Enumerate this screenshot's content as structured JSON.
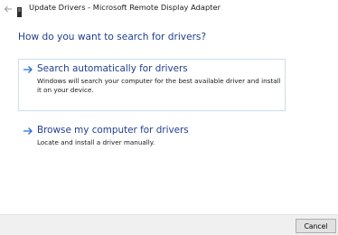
{
  "window": {
    "title": "Update Drivers - Microsoft Remote Display Adapter"
  },
  "header": {
    "question": "How do you want to search for drivers?"
  },
  "options": [
    {
      "title": "Search automatically for drivers",
      "description": "Windows will search your computer for the best available driver and install it on your device."
    },
    {
      "title": "Browse my computer for drivers",
      "description": "Locate and install a driver manually."
    }
  ],
  "footer": {
    "cancel_label": "Cancel"
  },
  "colors": {
    "link_blue": "#1f3f8f",
    "arrow_blue": "#2a6fd6",
    "highlight_border": "#c9dff0",
    "footer_bg": "#f0f0f0"
  },
  "icons": {
    "back": "back-arrow-icon",
    "app": "device-icon",
    "option_arrow": "right-arrow-icon"
  }
}
